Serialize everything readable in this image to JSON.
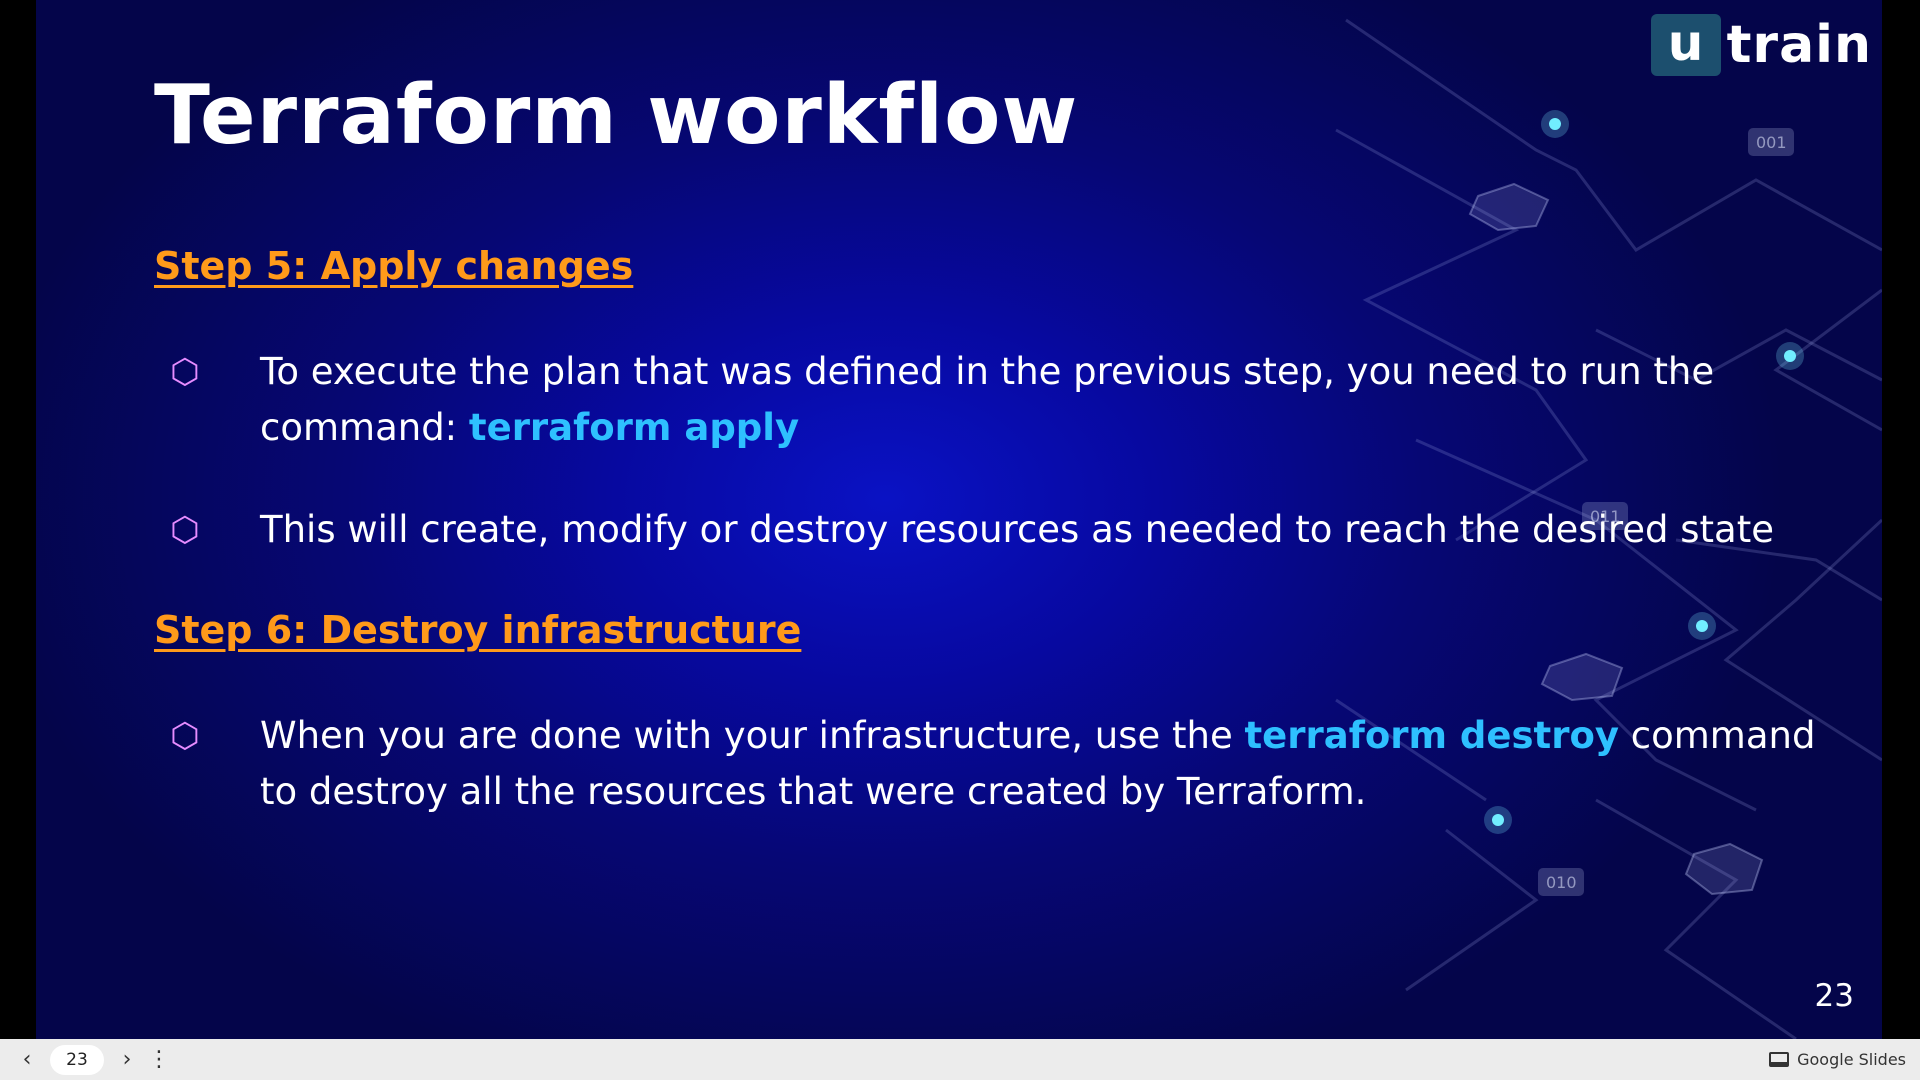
{
  "slide": {
    "title": "Terraform workflow",
    "logo": {
      "box_letter": "u",
      "word": "train"
    },
    "page_number": "23",
    "step5": {
      "heading": "Step 5: Apply changes",
      "bullet1": {
        "pre": "To execute the plan that was defined in the previous step, you need to run the command: ",
        "code": "terraform apply",
        "post": ""
      },
      "bullet2": "This will create, modify or destroy resources as needed to reach the desired state"
    },
    "step6": {
      "heading": "Step 6: Destroy infrastructure",
      "bullet1": {
        "pre": "When you are done with your infrastructure, use the ",
        "code": "terraform destroy",
        "post": " command to destroy all the resources that were created by Terraform."
      }
    },
    "bullet_glyph": "⬡",
    "decor_labels": [
      "001",
      "011",
      "010"
    ],
    "colors": {
      "heading": "#ff9a1a",
      "code": "#2ec0ff",
      "bullet": "#e68cff"
    }
  },
  "toolbar": {
    "prev_icon": "‹",
    "next_icon": "›",
    "current_page": "23",
    "menu_icon": "⋮",
    "brand": "Google Slides"
  }
}
